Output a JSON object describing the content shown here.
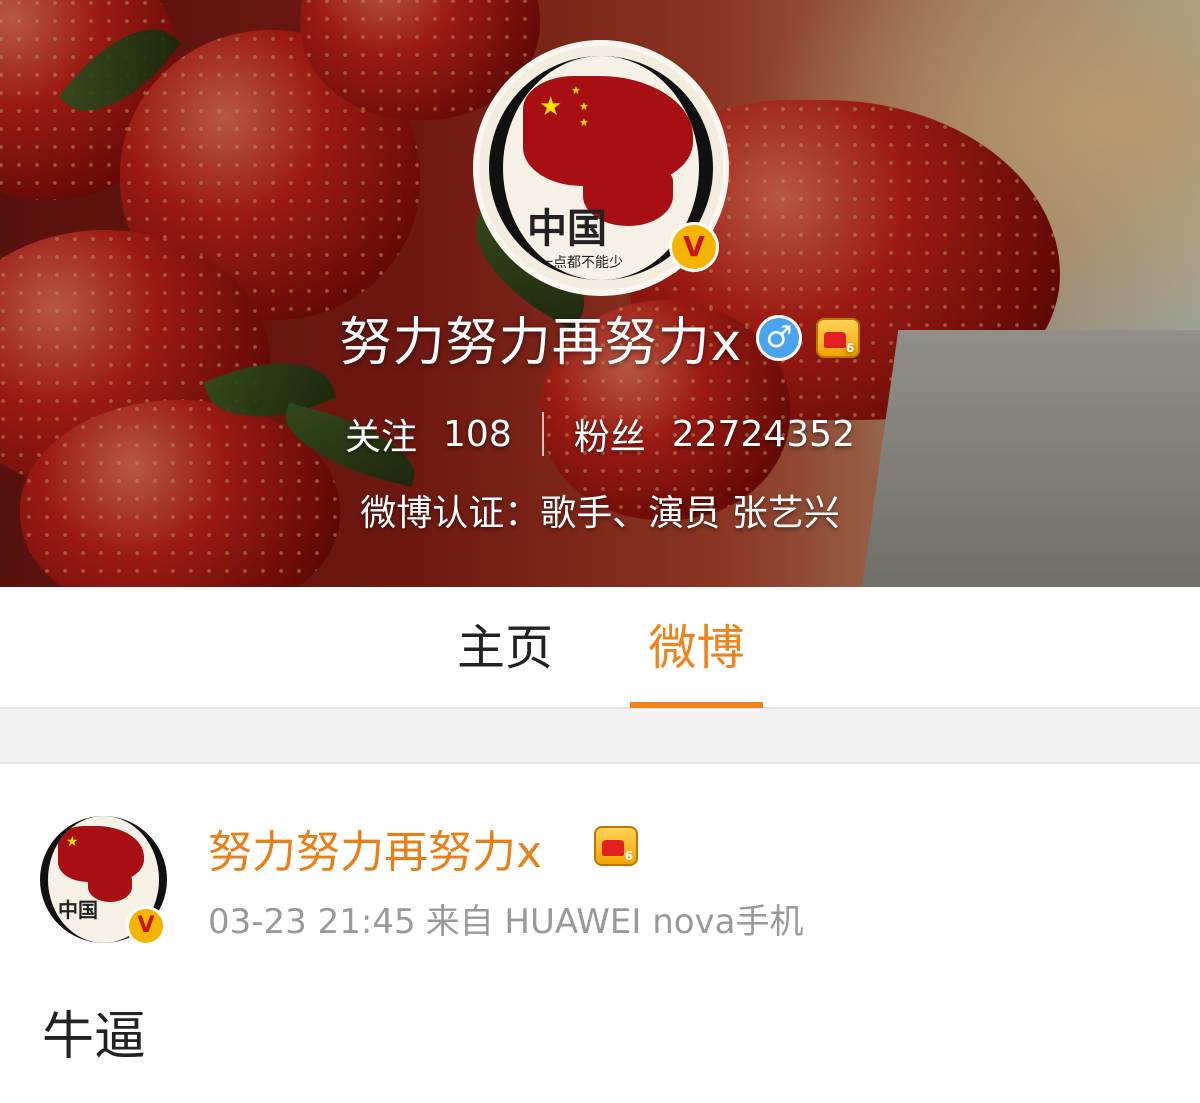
{
  "profile": {
    "name": "努力努力再努力x",
    "gender_icon": "male-icon",
    "gender_glyph": "♂",
    "verified_badge": "V",
    "vip_icon": "crown-level-6-icon",
    "avatar_text": "中国",
    "avatar_subtext": "一点都不能少",
    "following_label": "关注",
    "following_count": "108",
    "followers_label": "粉丝",
    "followers_count": "22724352",
    "verification": "微博认证：歌手、演员 张艺兴"
  },
  "tabs": [
    {
      "label": "主页",
      "active": false
    },
    {
      "label": "微博",
      "active": true
    }
  ],
  "post": {
    "author": "努力努力再努力x",
    "verified_badge": "V",
    "time": "03-23 21:45",
    "source": "来自 HUAWEI nova手机",
    "text": "牛逼"
  },
  "colors": {
    "accent_orange": "#f08219",
    "name_orange": "#e8801a",
    "meta_gray": "#999999",
    "gender_blue": "#4aa3ee"
  }
}
